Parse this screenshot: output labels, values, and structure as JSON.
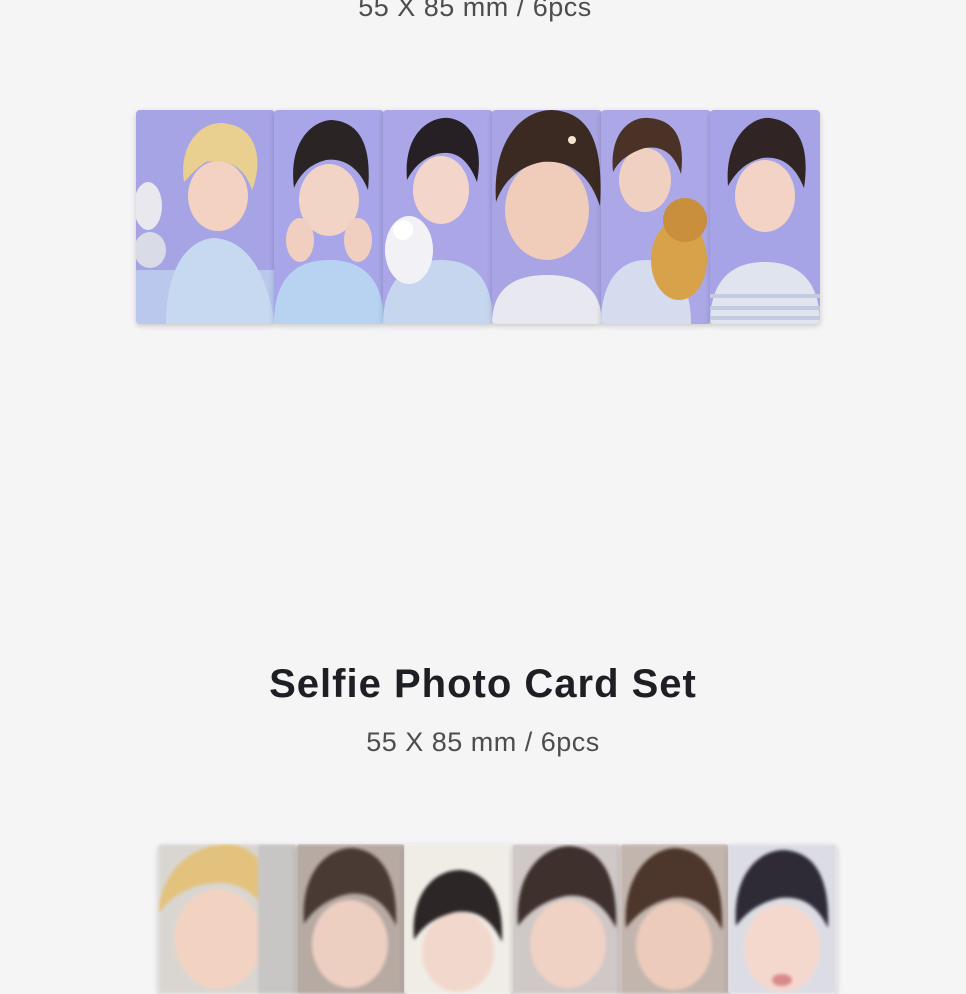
{
  "top_section": {
    "spec": "55 X 85 mm / 6pcs"
  },
  "selfie_section": {
    "title": "Selfie Photo Card Set",
    "spec": "55 X 85 mm / 6pcs"
  },
  "colors": {
    "background": "#f5f5f6",
    "title_text": "#1e1f24",
    "spec_text": "#4d4d4d",
    "card_backdrop": "#a9a6ea"
  }
}
